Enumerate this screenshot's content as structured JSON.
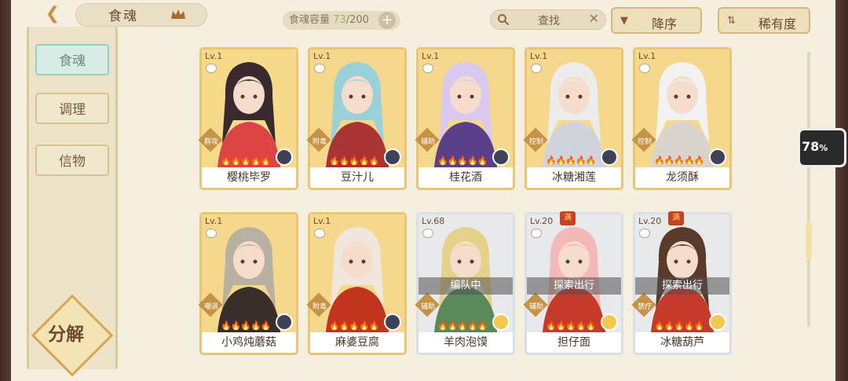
{
  "header": {
    "title": "食魂",
    "capacity_label": "食魂容量",
    "capacity_current": "73",
    "capacity_max": "/200",
    "search_placeholder": "查找",
    "sort_desc": "降序",
    "sort_rarity": "稀有度"
  },
  "sidebar": {
    "items": [
      {
        "label": "食魂",
        "active": true
      },
      {
        "label": "调理",
        "active": false
      },
      {
        "label": "信物",
        "active": false
      }
    ],
    "decompose": "分解"
  },
  "cards": [
    {
      "level": "Lv.1",
      "name": "樱桃毕罗",
      "role": "群攻",
      "elem": "dark",
      "status": "",
      "full": "",
      "colors": [
        "#f7d98a",
        "#3a2a30",
        "#d44"
      ]
    },
    {
      "level": "Lv.1",
      "name": "豆汁儿",
      "role": "附毒",
      "elem": "dark",
      "status": "",
      "full": "",
      "colors": [
        "#f6d88c",
        "#9ad0d8",
        "#a33"
      ]
    },
    {
      "level": "Lv.1",
      "name": "桂花酒",
      "role": "辅助",
      "elem": "dark",
      "status": "",
      "full": "",
      "colors": [
        "#f6d88c",
        "#d9c8f0",
        "#5a3f8a"
      ]
    },
    {
      "level": "Lv.1",
      "name": "冰糖湘莲",
      "role": "控制",
      "elem": "dark",
      "status": "",
      "full": "",
      "colors": [
        "#f6d88c",
        "#ececec",
        "#cfd4dc"
      ]
    },
    {
      "level": "Lv.1",
      "name": "龙须酥",
      "role": "控制",
      "elem": "dark",
      "status": "",
      "full": "",
      "colors": [
        "#f6d88c",
        "#f2f2f2",
        "#d8d4cc"
      ]
    },
    {
      "level": "Lv.1",
      "name": "小鸡炖蘑菇",
      "role": "嘲讽",
      "elem": "dark",
      "status": "",
      "full": "",
      "colors": [
        "#f6d88c",
        "#b8b0a0",
        "#3a2e2a"
      ]
    },
    {
      "level": "Lv.1",
      "name": "麻婆豆腐",
      "role": "附毒",
      "elem": "dark",
      "status": "",
      "full": "",
      "colors": [
        "#f6d88c",
        "#f0e6de",
        "#c2341e"
      ]
    },
    {
      "level": "Lv.68",
      "name": "羊肉泡馍",
      "role": "辅助",
      "elem": "gold",
      "status": "编队中",
      "full": "",
      "colors": [
        "#e8e9eb",
        "#e5d28a",
        "#5a8a5a"
      ]
    },
    {
      "level": "Lv.20",
      "name": "担仔面",
      "role": "辅助",
      "elem": "gold",
      "status": "探索出行",
      "full": "满",
      "colors": [
        "#e8e9eb",
        "#f3b8b8",
        "#c63a2a"
      ]
    },
    {
      "level": "Lv.20",
      "name": "冰糖葫芦",
      "role": "禁疗",
      "elem": "gold",
      "status": "探索出行",
      "full": "满",
      "colors": [
        "#e8e9eb",
        "#5a3a2a",
        "#c63a2a"
      ]
    }
  ],
  "battery": {
    "value": "78",
    "unit": "%"
  }
}
